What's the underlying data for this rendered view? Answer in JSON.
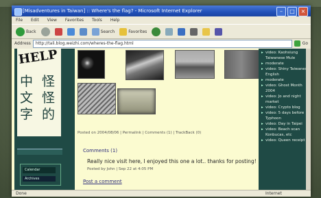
{
  "window": {
    "title": "[Misadventures in Taiwan] :: Where's the flag? - Microsoft Internet Explorer",
    "controls": [
      "–",
      "□",
      "×"
    ]
  },
  "menu": [
    "File",
    "Edit",
    "View",
    "Favorites",
    "Tools",
    "Help"
  ],
  "toolbar": {
    "back_label": "Back",
    "search_label": "Search",
    "favorites_label": "Favorites"
  },
  "address": {
    "label": "Address",
    "url": "http://tali.blog.weizhi.com/wheres-the-flag.html",
    "go_label": "Go"
  },
  "sidebar_left": {
    "logo_help": "HELP",
    "logo_chars": [
      "中",
      "文",
      "字",
      "怪",
      "怪",
      "的"
    ],
    "links": [
      "Calendar",
      "Archives"
    ]
  },
  "post": {
    "meta": "Posted on 2004/08/06 | Permalink | Comments (1) | TrackBack (0)",
    "comments_heading": "Comments (1)",
    "comment_text": "Really nice visit here, I enjoyed this one a lot.. thanks for posting!",
    "comment_meta": "Posted by John | Sep 22 at 4:05 PM",
    "post_link": "Post a comment"
  },
  "sidebar_right": {
    "items": [
      "video: Kaohsiung Taiwanese Mule",
      "moderate",
      "video: Shiny Taiwanese English",
      "moderate",
      "video: Ghost Month 2004",
      "video: Jo and night market",
      "video: Crypto blog",
      "video: 5 days before Typhoon",
      "video: Day in Taipei",
      "video: Beach scan Konbucas, etc",
      "video: Queen receipt"
    ]
  },
  "status": {
    "left": "Done",
    "zone": "Internet"
  },
  "colors": {
    "sidebar": "#1f4a45",
    "content_bg": "#fbfbd0",
    "title_bar": "#2150b8"
  }
}
